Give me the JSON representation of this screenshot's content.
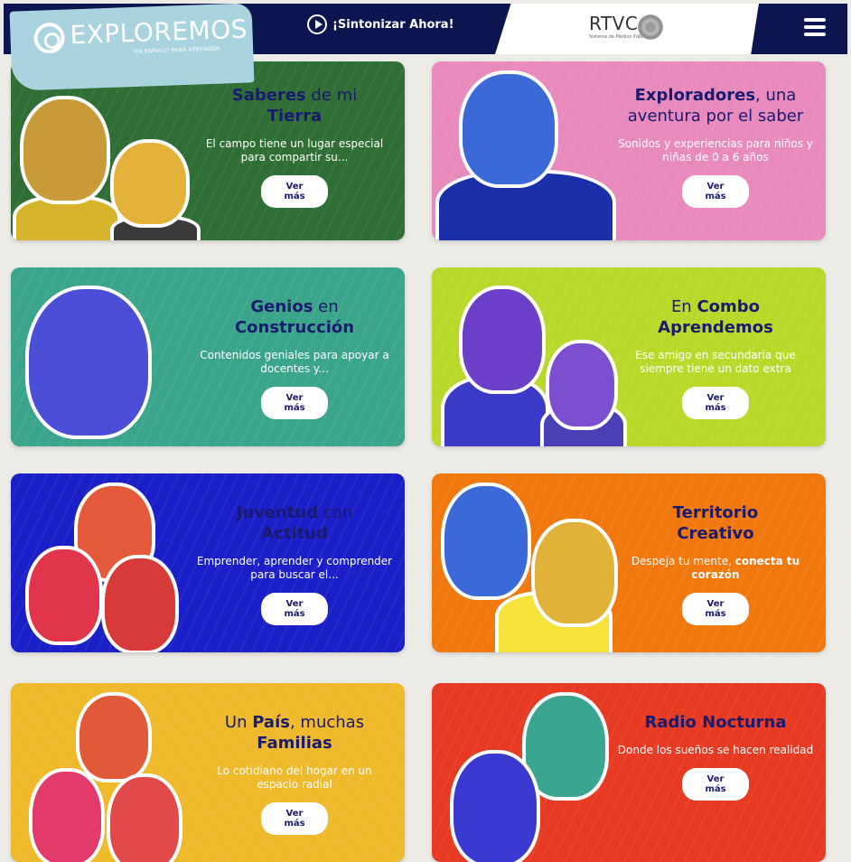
{
  "header": {
    "logo_text": "EXPLOREMOS",
    "logo_subtitle": "UN ESPACIO PARA APRENDER",
    "listen_label": "¡Sintonizar Ahora!",
    "rtvc_logo": "RTVC",
    "rtvc_subtitle": "Sistema de Medios Públicos"
  },
  "cards": [
    {
      "title_a": "Saberes",
      "title_b": " de mi ",
      "title_c": "Tierra",
      "desc": "El campo tiene un lugar especial para compartir su...",
      "button": "Ver más",
      "color": "#2f6e35"
    },
    {
      "title_a": "Exploradores",
      "title_b": ", una aventura por el saber",
      "title_c": "",
      "desc": "Sonidos y experiencias para niños y niñas de 0 a 6 años",
      "button": "Ver más",
      "color": "#e98abd"
    },
    {
      "title_a": "Genios",
      "title_b": " en ",
      "title_c": "Construcción",
      "desc": "Contenidos geniales para apoyar a docentes y...",
      "button": "Ver más",
      "color": "#3aa58a"
    },
    {
      "title_a": "En ",
      "title_b": "Combo",
      "title_c": "Aprendemos",
      "desc": "Ese amigo en secundaria que siempre tiene un dato extra",
      "button": "Ver más",
      "color": "#b9d92a"
    },
    {
      "title_a": "Juventud",
      "title_b": " con ",
      "title_c": "Actitud",
      "desc": "Emprender, aprender y comprender para buscar el...",
      "button": "Ver más",
      "color": "#1b1fc8"
    },
    {
      "title_a": "Territorio",
      "title_b": "",
      "title_c": "Creativo",
      "desc_a": "Despeja tu mente, ",
      "desc_b": "conecta tu corazón",
      "button": "Ver más",
      "color": "#f0780e"
    },
    {
      "title_a": "Un ",
      "title_b": "País",
      "title_c": ", muchas",
      "title_d": "Familias",
      "desc": "Lo cotidiano del hogar en un espacio radial",
      "button": "Ver más",
      "color": "#eeb92a"
    },
    {
      "title_a": "Radio Nocturna",
      "title_b": "",
      "title_c": "",
      "desc": "Donde los sueños se hacen realidad",
      "button": "Ver más",
      "color": "#e73a22"
    }
  ]
}
